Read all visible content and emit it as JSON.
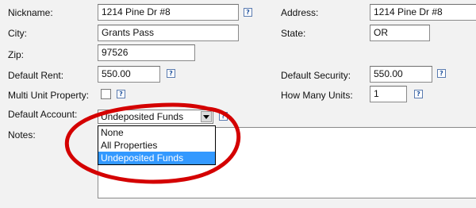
{
  "form": {
    "nickname": {
      "label": "Nickname:",
      "value": "1214 Pine Dr #8"
    },
    "address": {
      "label": "Address:",
      "value": "1214 Pine Dr #8"
    },
    "city": {
      "label": "City:",
      "value": "Grants Pass"
    },
    "state": {
      "label": "State:",
      "value": "OR"
    },
    "zip": {
      "label": "Zip:",
      "value": "97526"
    },
    "default_rent": {
      "label": "Default Rent:",
      "value": "550.00"
    },
    "default_security": {
      "label": "Default Security:",
      "value": "550.00"
    },
    "multi_unit": {
      "label": "Multi Unit Property:",
      "checked": false
    },
    "how_many_units": {
      "label": "How Many Units:",
      "value": "1"
    },
    "default_account": {
      "label": "Default Account:",
      "selected": "Undeposited Funds",
      "options": [
        "None",
        "All Properties",
        "Undeposited Funds"
      ]
    },
    "notes": {
      "label": "Notes:",
      "value": ""
    }
  },
  "help_glyph": "?",
  "colors": {
    "highlight_selected": "#3399ff",
    "annotation_circle": "#d40000",
    "help_icon": "#1c4f9c"
  },
  "icons": {
    "help": "help-icon",
    "dropdown": "chevron-down-icon"
  }
}
